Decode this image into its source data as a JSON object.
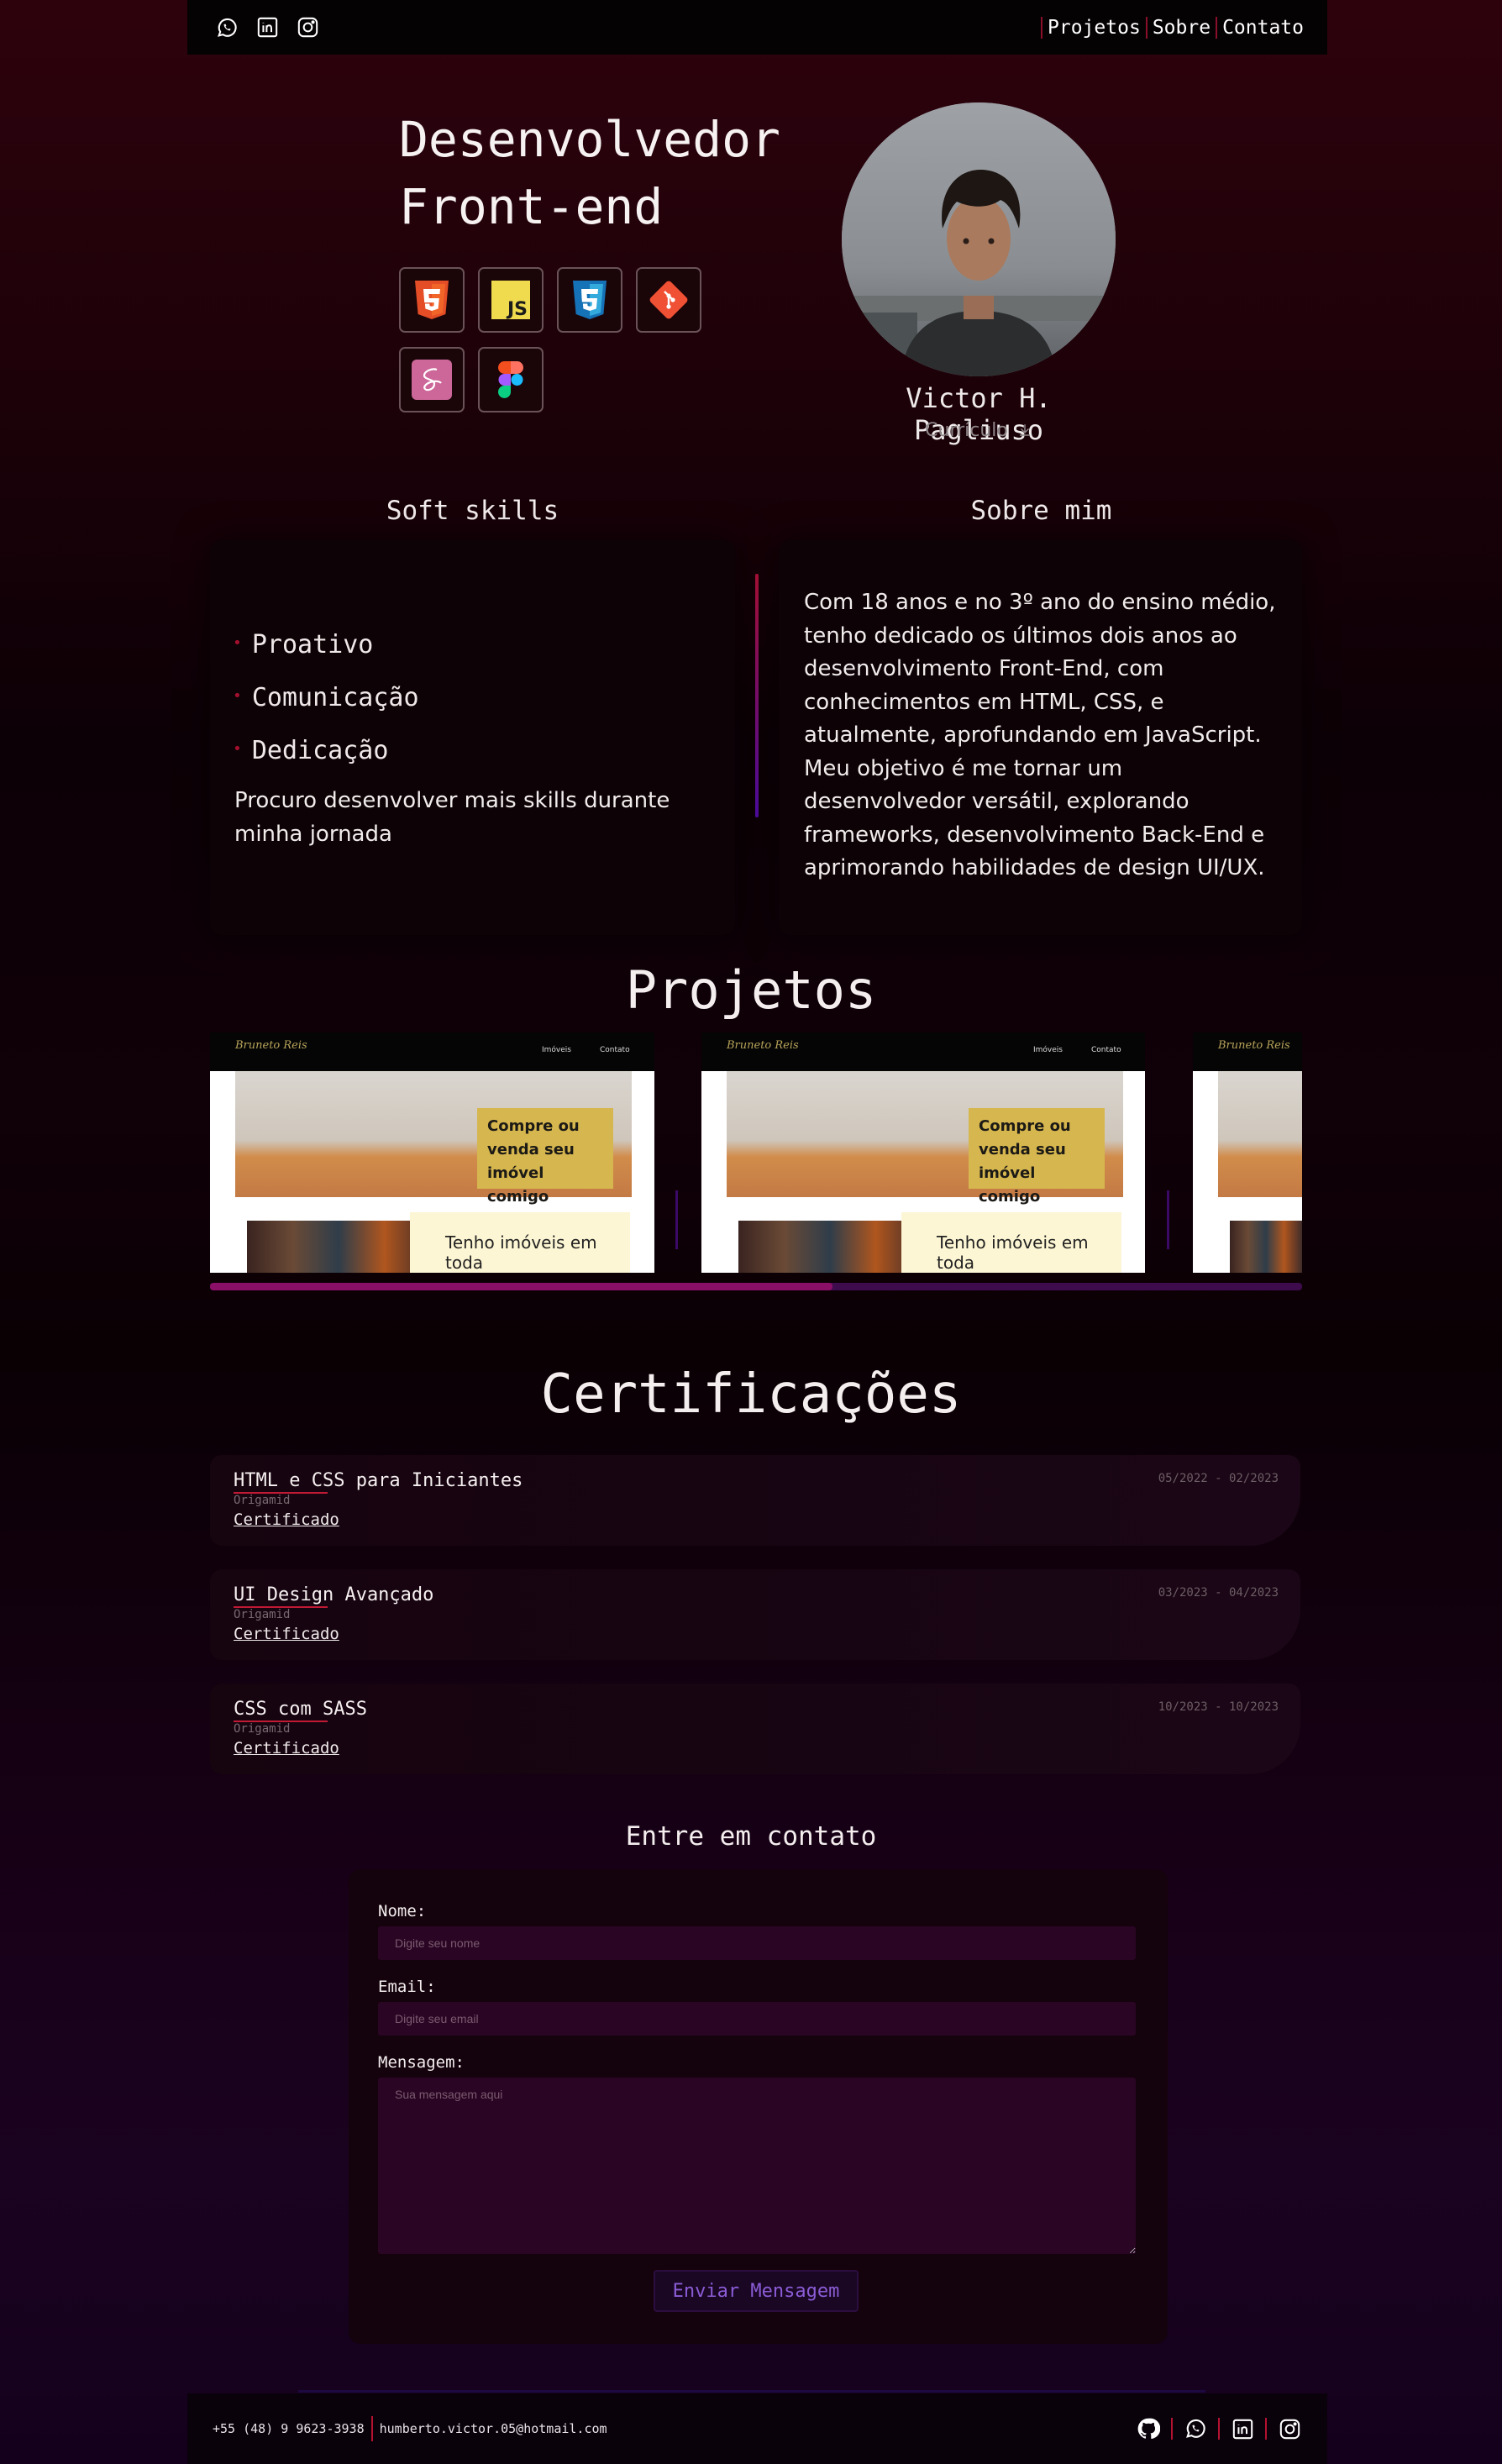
{
  "header": {
    "social_icons": [
      "whatsapp-icon",
      "linkedin-icon",
      "instagram-icon"
    ],
    "nav": [
      "Projetos",
      "Sobre",
      "Contato"
    ]
  },
  "hero": {
    "title_line1": "Desenvolvedor",
    "title_line2": "Front-end",
    "tech_icons": [
      "html5-icon",
      "javascript-icon",
      "css3-icon",
      "git-icon",
      "sass-icon",
      "figma-icon"
    ],
    "name": "Victor H. Pagliuso",
    "cv_label": "Currículo"
  },
  "skills": {
    "heading": "Soft skills",
    "items": [
      "Proativo",
      "Comunicação",
      "Dedicação"
    ],
    "note": "Procuro desenvolver mais skills durante minha jornada"
  },
  "about": {
    "heading": "Sobre mim",
    "text": "Com 18 anos e no 3º ano do ensino médio, tenho dedicado os últimos dois anos ao desenvolvimento Front-End, com conhecimentos em HTML, CSS, e atualmente, aprofundando em JavaScript. Meu objetivo é me tornar um desenvolvedor versátil, explorando frameworks, desenvolvimento Back-End e aprimorando habilidades de design UI/UX."
  },
  "projects": {
    "heading": "Projetos",
    "cards": [
      {
        "logo": "Bruneto Reis",
        "nav1": "Imóveis",
        "nav2": "Contato",
        "banner": "Compre ou venda seu imóvel comigo",
        "caption": "Tenho imóveis em toda"
      },
      {
        "logo": "Bruneto Reis",
        "nav1": "Imóveis",
        "nav2": "Contato",
        "banner": "Compre ou venda seu imóvel comigo",
        "caption": "Tenho imóveis em toda"
      },
      {
        "logo": "Bruneto Reis",
        "nav1": "",
        "nav2": "",
        "banner": "",
        "caption": ""
      }
    ],
    "scroll_position": 0.57
  },
  "certifications": {
    "heading": "Certificações",
    "items": [
      {
        "title": "HTML e CSS para Iniciantes",
        "org": "Origamid",
        "link": "Certificado",
        "date": "05/2022 - 02/2023"
      },
      {
        "title": "UI Design Avançado",
        "org": "Origamid",
        "link": "Certificado",
        "date": "03/2023 - 04/2023"
      },
      {
        "title": "CSS com SASS",
        "org": "Origamid",
        "link": "Certificado",
        "date": "10/2023 - 10/2023"
      }
    ]
  },
  "contact": {
    "heading": "Entre em contato",
    "name_label": "Nome:",
    "name_placeholder": "Digite seu nome",
    "email_label": "Email:",
    "email_placeholder": "Digite seu email",
    "message_label": "Mensagem:",
    "message_placeholder": "Sua mensagem aqui",
    "submit": "Enviar Mensagem"
  },
  "footer": {
    "phone": "+55 (48) 9 9623-3938",
    "email": "humberto.victor.05@hotmail.com",
    "icons": [
      "github-icon",
      "whatsapp-icon",
      "linkedin-icon",
      "instagram-icon"
    ]
  },
  "colors": {
    "accent_red": "#a30f2e",
    "accent_purple": "#8b5cd6"
  }
}
